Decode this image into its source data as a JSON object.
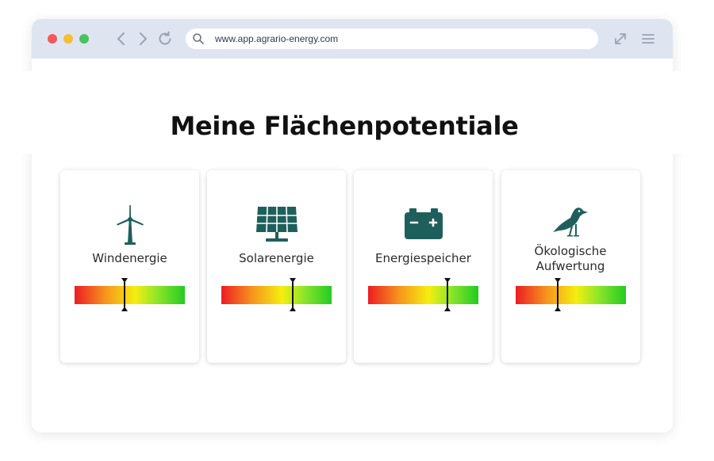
{
  "browser": {
    "url": "www.app.agrario-energy.com",
    "controls": {
      "close_color": "#f25a5a",
      "minimize_color": "#f6bd36",
      "maximize_color": "#45c55a"
    },
    "icons": [
      "back-arrow-icon",
      "forward-arrow-icon",
      "reload-icon",
      "search-icon",
      "expand-icon",
      "hamburger-menu-icon"
    ]
  },
  "page": {
    "title": "Meine Flächenpotentiale"
  },
  "cards": [
    {
      "id": "wind",
      "label": "Windenergie",
      "icon": "wind-turbine-icon",
      "potential": 0.45
    },
    {
      "id": "solar",
      "label": "Solarenergie",
      "icon": "solar-panel-icon",
      "potential": 0.65
    },
    {
      "id": "storage",
      "label": "Energiespeicher",
      "icon": "battery-icon",
      "potential": 0.72
    },
    {
      "id": "eco",
      "label": "Ökologische Aufwertung",
      "icon": "bird-icon",
      "potential": 0.38
    }
  ],
  "theme": {
    "icon_color": "#1f5f5b",
    "gauge_colors": [
      "#ec1c24",
      "#f7941d",
      "#f5ee0f",
      "#8ee52a",
      "#22cc22"
    ]
  }
}
